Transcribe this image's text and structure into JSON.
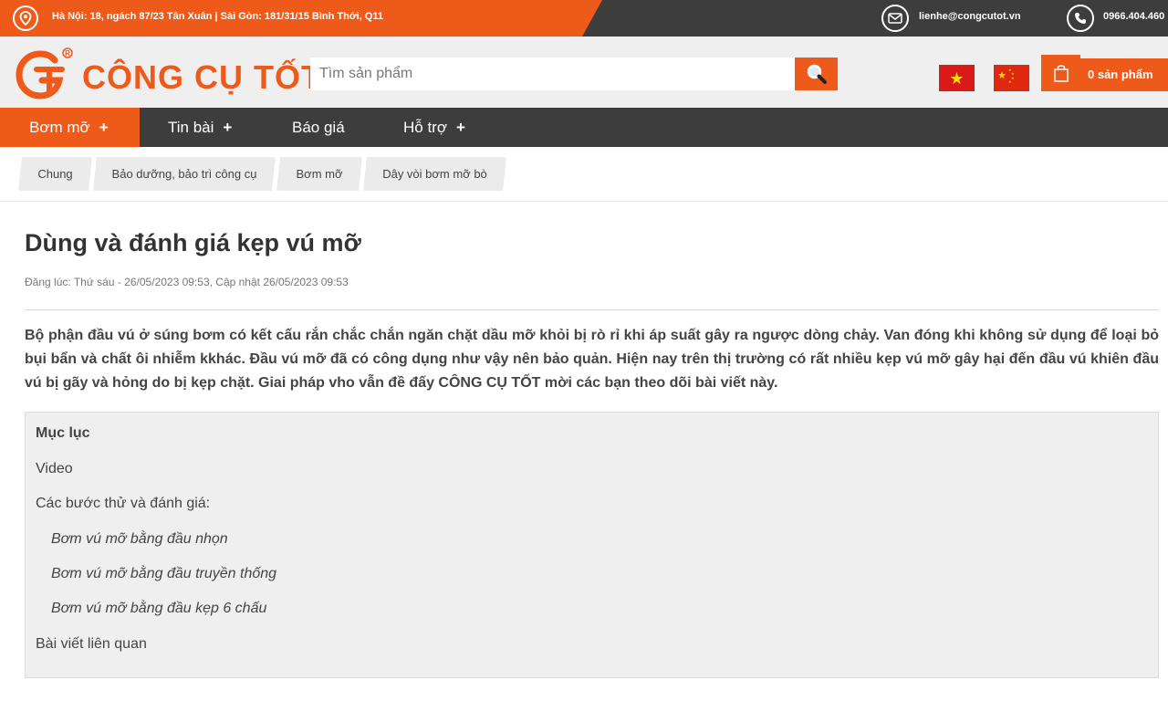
{
  "topbar": {
    "address": "Hà Nội: 18, ngách 87/23 Tân Xuân | Sài Gòn: 181/31/15 Bình Thới, Q11",
    "email": "lienhe@congcutot.vn",
    "phone": "0966.404.460"
  },
  "header": {
    "logo_text": "CÔNG CỤ TỐT",
    "search_placeholder": "Tìm sản phẩm",
    "cart_label": "0 sản phẩm"
  },
  "nav": {
    "items": [
      {
        "label": "Bơm mỡ",
        "has_submenu": true
      },
      {
        "label": "Tin bài",
        "has_submenu": true
      },
      {
        "label": "Báo giá",
        "has_submenu": false
      },
      {
        "label": "Hỗ trợ",
        "has_submenu": true
      }
    ],
    "plus": "+"
  },
  "breadcrumb": [
    "Chung",
    "Bảo dưỡng, bảo trì công cụ",
    "Bơm mỡ",
    "Dây vòi bơm mỡ bò"
  ],
  "article": {
    "title": "Dùng và đánh giá kẹp vú mỡ",
    "meta": "Đăng lúc: Thứ sáu - 26/05/2023 09:53, Cập nhật 26/05/2023 09:53",
    "intro": "Bộ phận đầu vú ở súng bơm có kết cấu rắn chắc chắn ngăn chặt dầu mỡ khỏi bị rò rỉ khi áp suất gây ra ngược dòng chảy. Van đóng khi không sử dụng để loại bỏ bụi bẩn và chất ôi nhiễm kkhác. Đầu vú mỡ đã có công dụng như vậy nên bảo quản. Hiện nay trên thị trường có rất nhiều kẹp vú mỡ gây hại đến đầu vú khiên đầu vú bị gãy và hỏng do bị kẹp chặt. Giai pháp vho vẫn đề đấy CÔNG CỤ TỐT mời các bạn theo dõi bài viết này."
  },
  "toc": {
    "title": "Mục lục",
    "items": [
      "Video",
      "Các bước thử và đánh giá:",
      "Bơm vú mỡ bằng đầu nhọn",
      "Bơm vú mỡ bằng đầu truyền thống",
      "Bơm vú mỡ bằng đầu kẹp 6 chấu",
      "Bài viết liên quan"
    ]
  },
  "colors": {
    "brand_orange": "#ee5a1a",
    "dark_bar": "#3d3d3d"
  }
}
